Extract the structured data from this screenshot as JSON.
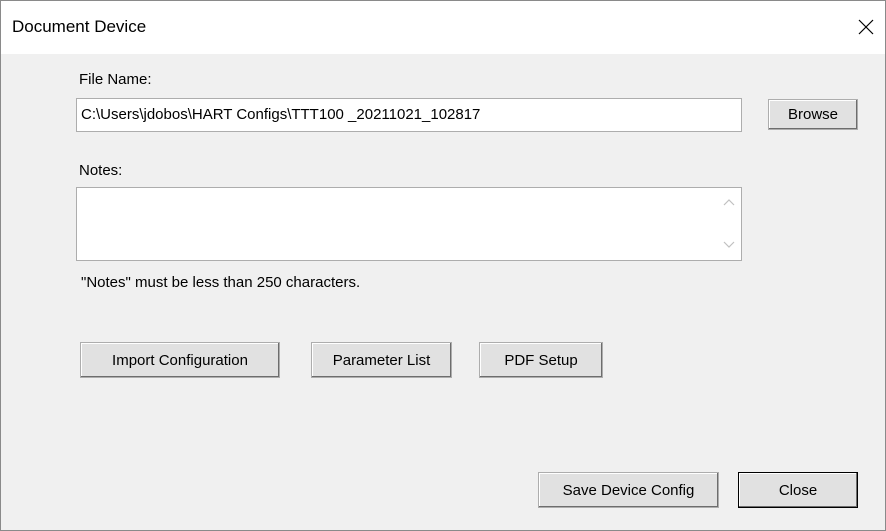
{
  "window": {
    "title": "Document Device",
    "close_icon": "close-icon"
  },
  "file_name": {
    "label": "File Name:",
    "value": "C:\\Users\\jdobos\\HART Configs\\TTT100  _20211021_102817",
    "browse_label": "Browse"
  },
  "notes": {
    "label": "Notes:",
    "value": "",
    "hint": "\"Notes\" must be less than 250 characters."
  },
  "actions": {
    "import_label": "Import Configuration",
    "parameter_list_label": "Parameter List",
    "pdf_setup_label": "PDF Setup"
  },
  "footer": {
    "save_label": "Save Device Config",
    "close_label": "Close"
  }
}
